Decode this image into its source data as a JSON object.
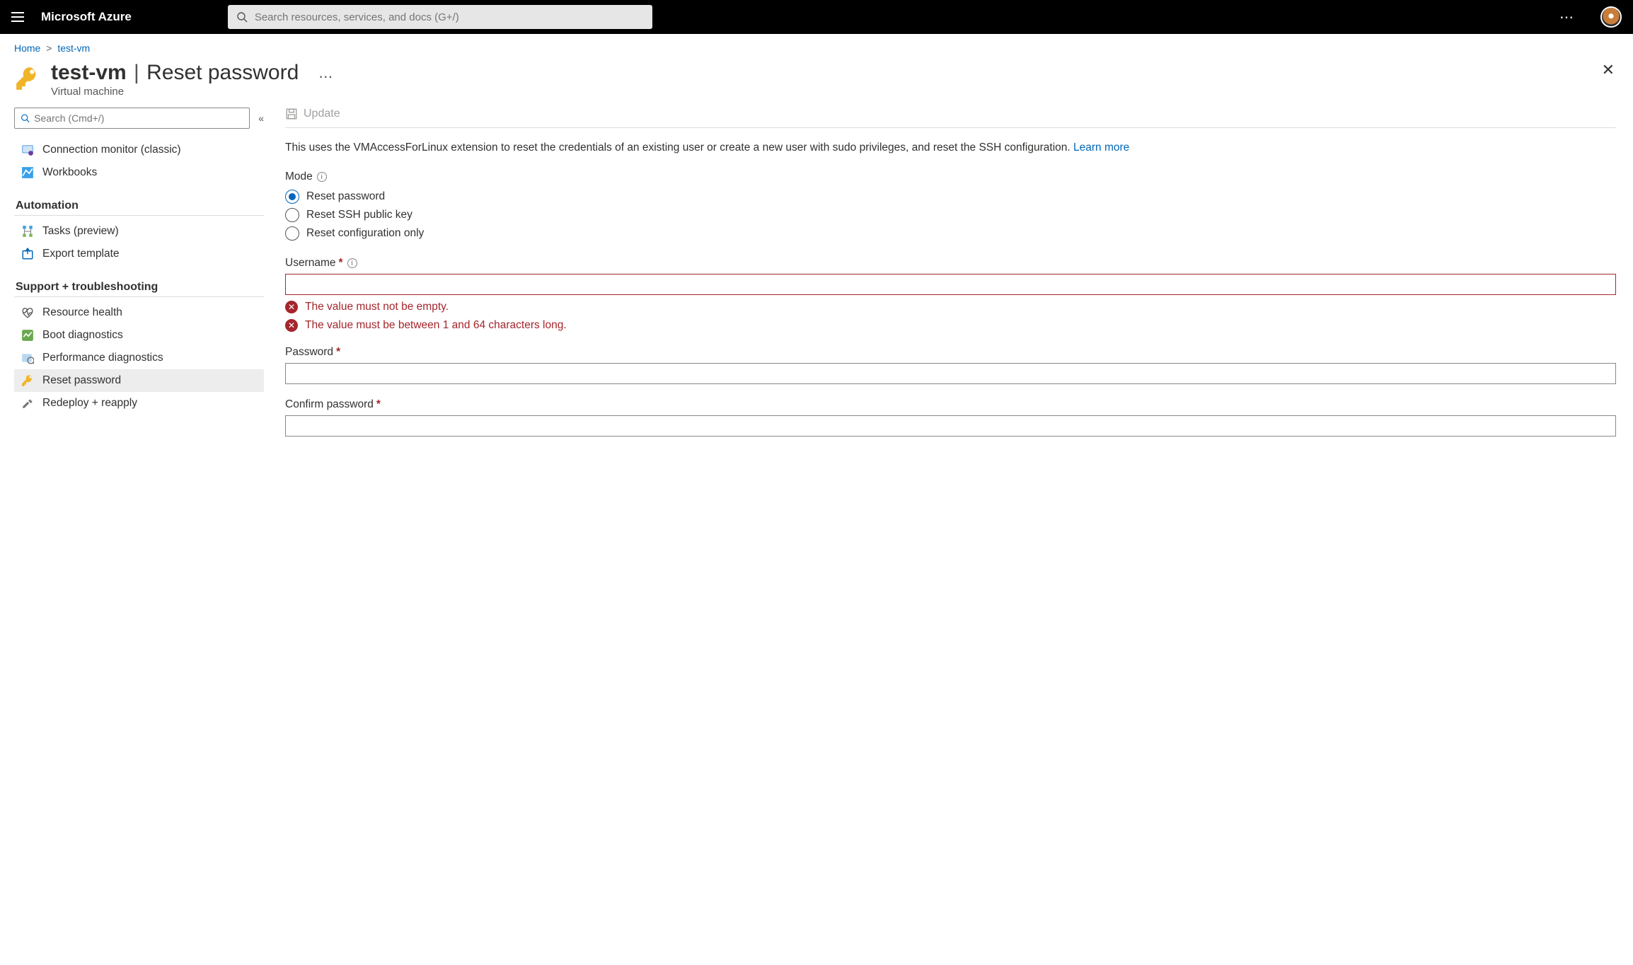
{
  "topbar": {
    "brand": "Microsoft Azure",
    "search_placeholder": "Search resources, services, and docs (G+/)"
  },
  "breadcrumb": {
    "home": "Home",
    "resource": "test-vm"
  },
  "header": {
    "vm_name": "test-vm",
    "page": "Reset password",
    "subtitle": "Virtual machine"
  },
  "sidebar": {
    "search_placeholder": "Search (Cmd+/)",
    "items_top": [
      {
        "label": "Connection monitor (classic)"
      },
      {
        "label": "Workbooks"
      }
    ],
    "section_automation": "Automation",
    "items_automation": [
      {
        "label": "Tasks (preview)"
      },
      {
        "label": "Export template"
      }
    ],
    "section_support": "Support + troubleshooting",
    "items_support": [
      {
        "label": "Resource health"
      },
      {
        "label": "Boot diagnostics"
      },
      {
        "label": "Performance diagnostics"
      },
      {
        "label": "Reset password"
      },
      {
        "label": "Redeploy + reapply"
      }
    ]
  },
  "toolbar": {
    "update": "Update"
  },
  "main": {
    "description": "This uses the VMAccessForLinux extension to reset the credentials of an existing user or create a new user with sudo privileges, and reset the SSH configuration. ",
    "learn_more": "Learn more",
    "mode_label": "Mode",
    "mode_options": [
      "Reset password",
      "Reset SSH public key",
      "Reset configuration only"
    ],
    "username_label": "Username",
    "username_errors": [
      "The value must not be empty.",
      "The value must be between 1 and 64 characters long."
    ],
    "password_label": "Password",
    "confirm_label": "Confirm password"
  }
}
